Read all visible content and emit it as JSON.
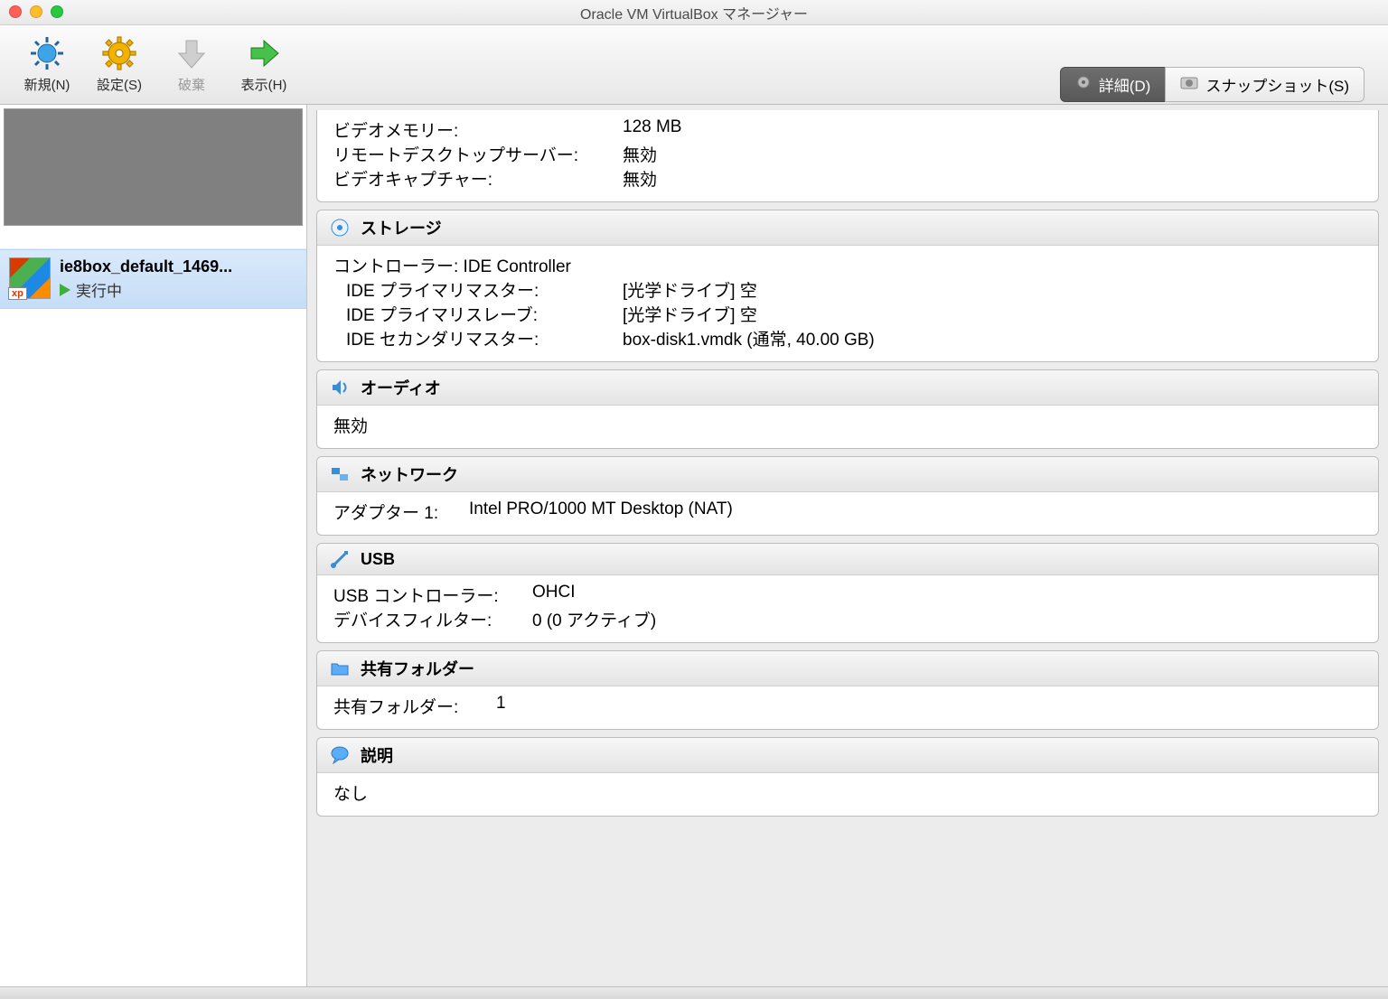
{
  "window": {
    "title": "Oracle VM VirtualBox マネージャー"
  },
  "toolbar": {
    "new": "新規(N)",
    "settings": "設定(S)",
    "discard": "破棄",
    "show": "表示(H)"
  },
  "tabs": {
    "details": "詳細(D)",
    "snapshots": "スナップショット(S)"
  },
  "sidebar": {
    "vm": {
      "name": "ie8box_default_1469...",
      "state": "実行中"
    }
  },
  "details": {
    "display": {
      "video_mem_label": "ビデオメモリー:",
      "video_mem_value": "128 MB",
      "rdp_label": "リモートデスクトップサーバー:",
      "rdp_value": "無効",
      "capture_label": "ビデオキャプチャー:",
      "capture_value": "無効"
    },
    "storage": {
      "title": "ストレージ",
      "controller_label": "コントローラー: IDE Controller",
      "rows": [
        {
          "key": "IDE プライマリマスター:",
          "val": "[光学ドライブ] 空"
        },
        {
          "key": "IDE プライマリスレーブ:",
          "val": "[光学ドライブ] 空"
        },
        {
          "key": "IDE セカンダリマスター:",
          "val": "box-disk1.vmdk (通常, 40.00 GB)"
        }
      ]
    },
    "audio": {
      "title": "オーディオ",
      "value": "無効"
    },
    "network": {
      "title": "ネットワーク",
      "adapter_label": "アダプター 1:",
      "adapter_value": "Intel PRO/1000 MT Desktop (NAT)"
    },
    "usb": {
      "title": "USB",
      "controller_label": "USB コントローラー:",
      "controller_value": "OHCI",
      "filter_label": "デバイスフィルター:",
      "filter_value": "0 (0 アクティブ)"
    },
    "shared": {
      "title": "共有フォルダー",
      "label": "共有フォルダー:",
      "value": "1"
    },
    "description": {
      "title": "説明",
      "value": "なし"
    }
  }
}
